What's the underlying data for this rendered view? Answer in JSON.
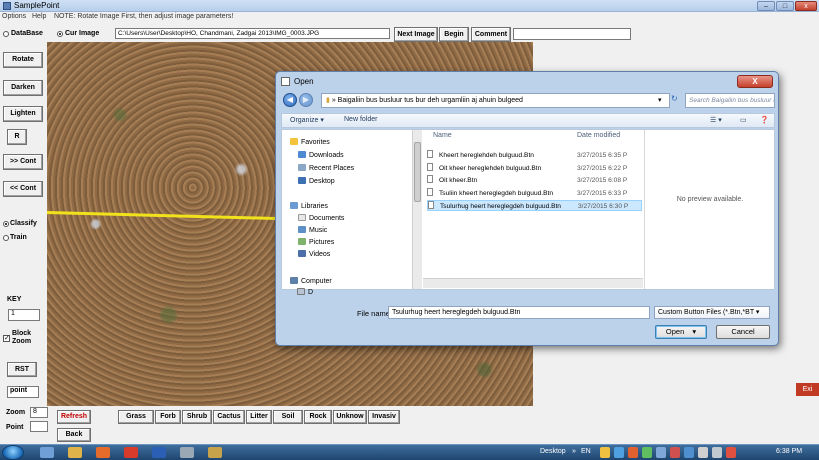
{
  "window": {
    "title": "SamplePoint",
    "min": "–",
    "max": "□",
    "close": "x"
  },
  "menu": {
    "options": "Options",
    "help": "Help",
    "note": "NOTE: Rotate Image First, then adjust image parameters!"
  },
  "top": {
    "database_label": "DataBase",
    "curimage_label": "Cur Image",
    "path": "C:\\Users\\User\\Desktop\\HO, Chandmani, Zadgai 2013\\IMG_0003.JPG",
    "next_image": "Next Image",
    "begin": "Begin",
    "comment": "Comment",
    "comment_value": ""
  },
  "left": {
    "rotate": "Rotate",
    "darken": "Darken",
    "lighten": "Lighten",
    "r": "R",
    "cont_fwd": ">> Cont",
    "cont_back": "<< Cont",
    "classify": "Classify",
    "train": "Train",
    "key_label": "KEY",
    "key_value": "1",
    "block_zoom_1": "Block",
    "block_zoom_2": "Zoom",
    "rst": "RST",
    "point_value": "point"
  },
  "bottom": {
    "zoom_label": "Zoom",
    "zoom_value": "8",
    "point_label": "Point",
    "point_value": "",
    "refresh": "Refresh",
    "back": "Back",
    "categories": [
      "Grass",
      "Forb",
      "Shrub",
      "Cactus",
      "Litter",
      "Soil",
      "Rock",
      "Unknow",
      "Invasiv"
    ]
  },
  "exit": "Exi",
  "dialog": {
    "title": "Open",
    "close": "X",
    "breadcrumb_root": "»",
    "breadcrumb": "Baigaliin bus busluur tus bur deh urgamliin aj ahuin bulgeed",
    "search_placeholder": "Search Baigaliin bus busluur t...",
    "organize": "Organize ▾",
    "new_folder": "New folder",
    "nav": {
      "favorites": "Favorites",
      "downloads": "Downloads",
      "recent": "Recent Places",
      "desktop": "Desktop",
      "libraries": "Libraries",
      "documents": "Documents",
      "music": "Music",
      "pictures": "Pictures",
      "videos": "Videos",
      "computer": "Computer",
      "drive_d": "D"
    },
    "columns": {
      "name": "Name",
      "date": "Date modified"
    },
    "files": [
      {
        "name": "Kheert hereglehdeh bulguud.Btn",
        "date": "3/27/2015 6:35 P"
      },
      {
        "name": "Oit kheer hereglehdeh bulguud.Btn",
        "date": "3/27/2015 6:22 P"
      },
      {
        "name": "Oit kheer.Btn",
        "date": "3/27/2015 6:08 P"
      },
      {
        "name": "Tsuliin kheert hereglegdeh bulguud.Btn",
        "date": "3/27/2015 6:33 P"
      },
      {
        "name": "Tsulurhug heert hereglegdeh bulguud.Btn",
        "date": "3/27/2015 6:30 P"
      }
    ],
    "preview": "No preview available.",
    "filename_label": "File name:",
    "filename": "Tsulurhug heert hereglegdeh bulguud.Btn",
    "filter": "Custom Button Files (*.Btn,*BT ▾",
    "open": "Open",
    "cancel": "Cancel"
  },
  "taskbar": {
    "desktop": "Desktop",
    "chevron": "»",
    "lang": "EN",
    "time": "6:38 PM"
  }
}
